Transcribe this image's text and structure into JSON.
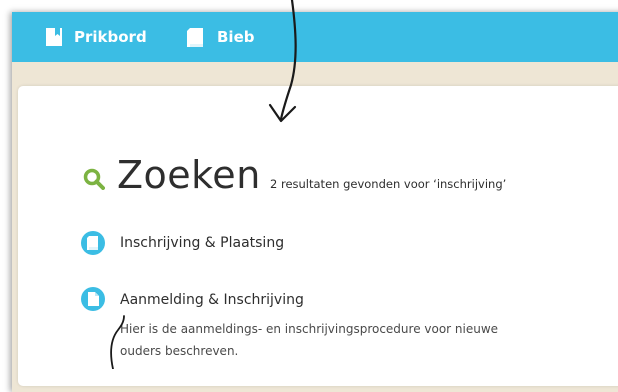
{
  "nav": {
    "items": [
      {
        "label": "Prikbord",
        "icon": "bookmark-icon"
      },
      {
        "label": "Bieb",
        "icon": "book-icon"
      }
    ]
  },
  "search": {
    "title": "Zoeken",
    "summary": "2 resultaten gevonden voor ‘inschrijving’"
  },
  "results": [
    {
      "title": "Inschrijving & Plaatsing",
      "icon": "book-icon"
    },
    {
      "title": "Aanmelding & Inschrijving",
      "icon": "document-icon",
      "description": "Hier is de aanmeldings- en inschrijvingsprocedure voor nieuwe ouders beschreven."
    }
  ],
  "colors": {
    "topbar": "#3bbde4",
    "background": "#eee6d5",
    "search_icon": "#7cb342",
    "text": "#2e2e2e"
  }
}
